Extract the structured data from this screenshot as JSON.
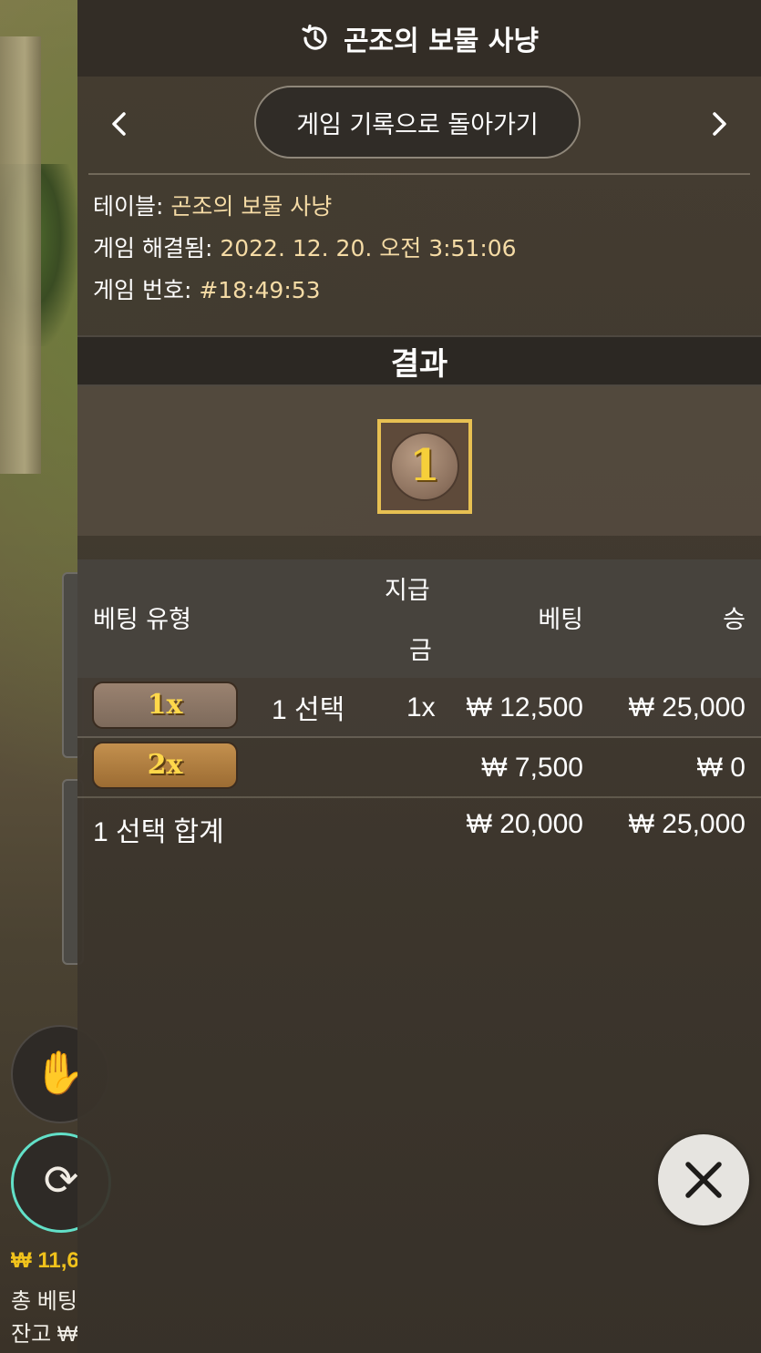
{
  "header": {
    "title": "곤조의 보물 사냥",
    "icon": "history-icon"
  },
  "nav": {
    "back_label": "게임 기록으로 돌아가기",
    "prev_icon": "chevron-left-icon",
    "next_icon": "chevron-right-icon"
  },
  "info": {
    "table_label": "테이블: ",
    "table_value": "곤조의 보물 사냥",
    "resolved_label": "게임 해결됨: ",
    "resolved_value": "2022. 12. 20. 오전 3:51:06",
    "round_label": "게임 번호: ",
    "round_value": "#18:49:53"
  },
  "result": {
    "label": "결과",
    "symbol": "1"
  },
  "table": {
    "headers": {
      "bet_type": "베팅 유형",
      "payout_line1": "지급",
      "payout_line2": "금",
      "bet": "베팅",
      "win": "승"
    },
    "rows": [
      {
        "badge": "1x",
        "selection": "1 선택",
        "payout": "1x",
        "bet": "₩ 12,500",
        "win": "₩ 25,000"
      },
      {
        "badge": "2x",
        "selection": "",
        "payout": "",
        "bet": "₩ 7,500",
        "win": "₩ 0"
      }
    ],
    "total": {
      "label": "1 선택 합계",
      "bet": "₩ 20,000",
      "win": "₩ 25,000"
    }
  },
  "close": {
    "icon": "close-icon"
  },
  "background": {
    "balance_partial": "₩ 11,6",
    "total_bet_partial": "총 베팅",
    "balance_label_partial": "잔고 ₩"
  },
  "colors": {
    "info_value": "#f5dba5",
    "badge_text": "#ffd84a",
    "tile_border": "#e7c052",
    "repeat_ring": "#62e0c8",
    "balance_gold": "#f0c21c"
  }
}
